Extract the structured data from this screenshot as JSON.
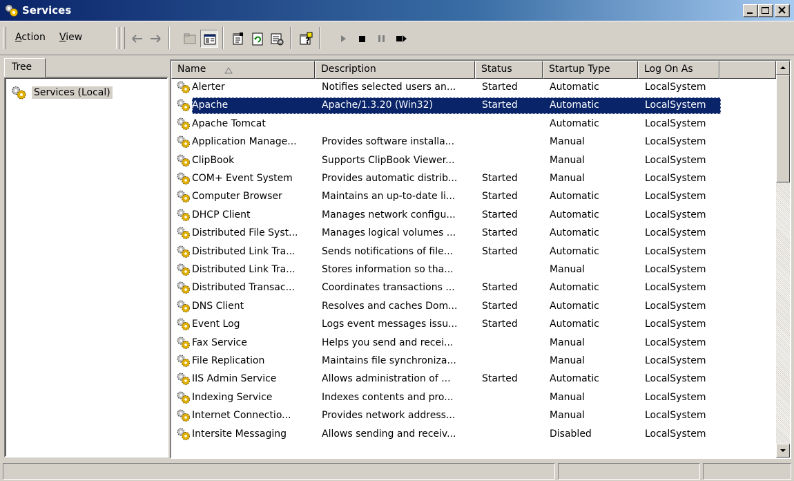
{
  "window": {
    "title": "Services",
    "icon": "services-gear-icon",
    "controls": [
      "minimize-icon",
      "maximize-icon",
      "close-icon"
    ]
  },
  "toolbar": {
    "menus": [
      {
        "label": "Action",
        "mnemonic": "A"
      },
      {
        "label": "View",
        "mnemonic": "V"
      }
    ],
    "tools": [
      "back-arrow-icon",
      "forward-arrow-icon",
      "up-folder-icon",
      "show-hide-tree-icon",
      "properties-icon",
      "refresh-icon",
      "export-list-icon",
      "help-icon",
      "start-service-icon",
      "stop-service-icon",
      "pause-service-icon",
      "restart-service-icon"
    ]
  },
  "tree": {
    "tab_label": "Tree",
    "root_label": "Services (Local)"
  },
  "list": {
    "columns": [
      "Name",
      "Description",
      "Status",
      "Startup Type",
      "Log On As"
    ],
    "sort_column": "Name",
    "rows": [
      {
        "name": "Alerter",
        "description": "Notifies selected users an...",
        "status": "Started",
        "startup": "Automatic",
        "logon": "LocalSystem"
      },
      {
        "name": "Apache",
        "description": "Apache/1.3.20 (Win32)",
        "status": "Started",
        "startup": "Automatic",
        "logon": "LocalSystem",
        "selected": true
      },
      {
        "name": "Apache Tomcat",
        "description": "",
        "status": "",
        "startup": "Automatic",
        "logon": "LocalSystem"
      },
      {
        "name": "Application Manage...",
        "description": "Provides software installa...",
        "status": "",
        "startup": "Manual",
        "logon": "LocalSystem"
      },
      {
        "name": "ClipBook",
        "description": "Supports ClipBook Viewer...",
        "status": "",
        "startup": "Manual",
        "logon": "LocalSystem"
      },
      {
        "name": "COM+ Event System",
        "description": "Provides automatic distrib...",
        "status": "Started",
        "startup": "Manual",
        "logon": "LocalSystem"
      },
      {
        "name": "Computer Browser",
        "description": "Maintains an up-to-date li...",
        "status": "Started",
        "startup": "Automatic",
        "logon": "LocalSystem"
      },
      {
        "name": "DHCP Client",
        "description": "Manages network configu...",
        "status": "Started",
        "startup": "Automatic",
        "logon": "LocalSystem"
      },
      {
        "name": "Distributed File Syst...",
        "description": "Manages logical volumes ...",
        "status": "Started",
        "startup": "Automatic",
        "logon": "LocalSystem"
      },
      {
        "name": "Distributed Link Tra...",
        "description": "Sends notifications of file...",
        "status": "Started",
        "startup": "Automatic",
        "logon": "LocalSystem"
      },
      {
        "name": "Distributed Link Tra...",
        "description": "Stores information so tha...",
        "status": "",
        "startup": "Manual",
        "logon": "LocalSystem"
      },
      {
        "name": "Distributed Transac...",
        "description": "Coordinates transactions ...",
        "status": "Started",
        "startup": "Automatic",
        "logon": "LocalSystem"
      },
      {
        "name": "DNS Client",
        "description": "Resolves and caches Dom...",
        "status": "Started",
        "startup": "Automatic",
        "logon": "LocalSystem"
      },
      {
        "name": "Event Log",
        "description": "Logs event messages issu...",
        "status": "Started",
        "startup": "Automatic",
        "logon": "LocalSystem"
      },
      {
        "name": "Fax Service",
        "description": "Helps you send and recei...",
        "status": "",
        "startup": "Manual",
        "logon": "LocalSystem"
      },
      {
        "name": "File Replication",
        "description": "Maintains file synchroniza...",
        "status": "",
        "startup": "Manual",
        "logon": "LocalSystem"
      },
      {
        "name": "IIS Admin Service",
        "description": "Allows administration of ...",
        "status": "Started",
        "startup": "Automatic",
        "logon": "LocalSystem"
      },
      {
        "name": "Indexing Service",
        "description": "Indexes contents and pro...",
        "status": "",
        "startup": "Manual",
        "logon": "LocalSystem"
      },
      {
        "name": "Internet Connectio...",
        "description": "Provides network address...",
        "status": "",
        "startup": "Manual",
        "logon": "LocalSystem"
      },
      {
        "name": "Intersite Messaging",
        "description": "Allows sending and receiv...",
        "status": "",
        "startup": "Disabled",
        "logon": "LocalSystem"
      }
    ]
  },
  "colors": {
    "title_start": "#0a246a",
    "title_end": "#a6caf0",
    "selection": "#0a246a",
    "face": "#d4d0c8"
  }
}
